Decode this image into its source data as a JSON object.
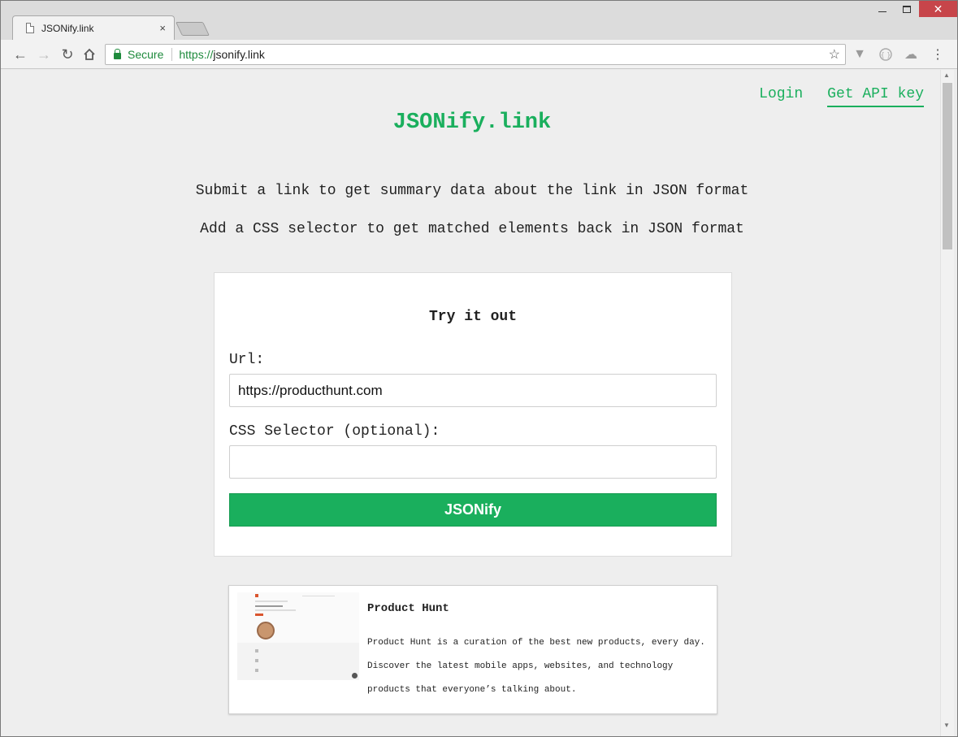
{
  "browser": {
    "tab_title": "JSONify.link",
    "tab_close": "×",
    "secure_label": "Secure",
    "url_scheme": "https://",
    "url_rest": "jsonify.link",
    "window_buttons": {
      "close": "✕"
    }
  },
  "page": {
    "nav": {
      "login": "Login",
      "api_key": "Get API key"
    },
    "logo": "JSONify.link",
    "taglines": [
      "Submit a link to get summary data about the link in JSON format",
      "Add a CSS selector to get matched elements back in JSON format"
    ],
    "form": {
      "title": "Try it out",
      "url_label": "Url:",
      "url_value": "https://producthunt.com",
      "selector_label": "CSS Selector (optional):",
      "selector_value": "",
      "submit_label": "JSONify"
    },
    "result": {
      "title": "Product Hunt",
      "description": "Product Hunt is a curation of the best new products, every day. Discover the latest mobile apps, websites, and technology products that everyone’s talking about."
    }
  },
  "colors": {
    "accent": "#1aaf5d",
    "close_button": "#c7454a"
  }
}
